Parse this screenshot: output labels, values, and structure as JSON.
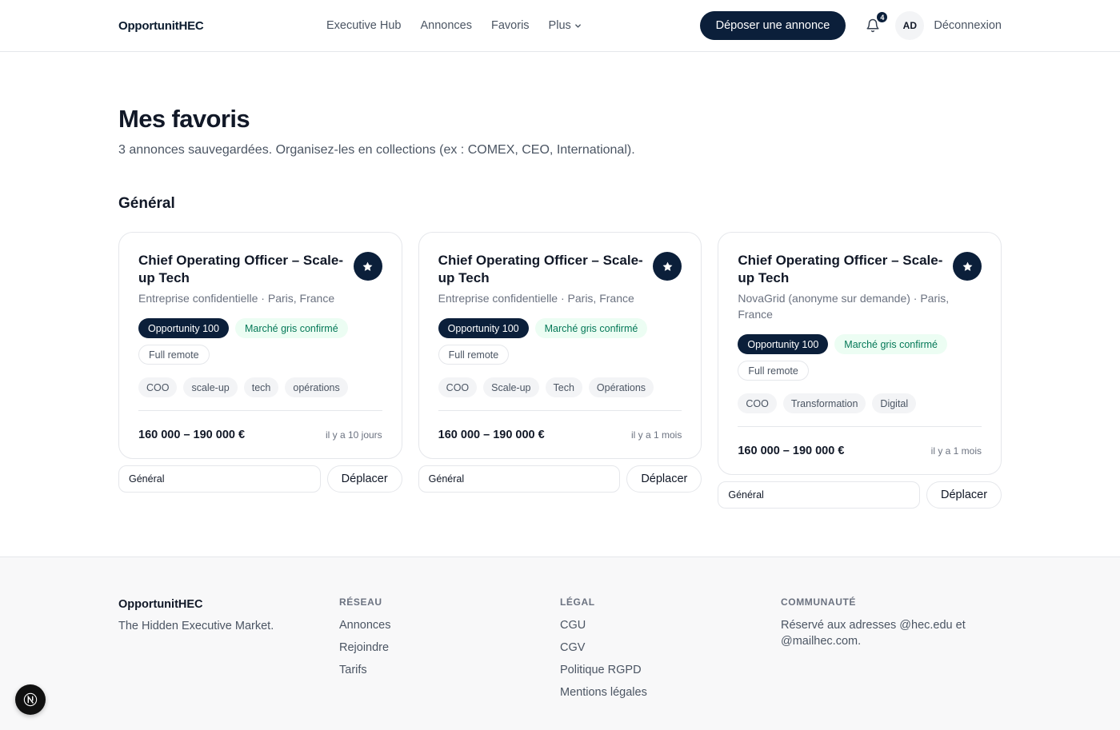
{
  "header": {
    "logo": "OpportunitHEC",
    "nav": [
      "Executive Hub",
      "Annonces",
      "Favoris",
      "Plus"
    ],
    "post_button": "Déposer une annonce",
    "notifications_count": "4",
    "avatar_initials": "AD",
    "logout": "Déconnexion"
  },
  "page": {
    "title": "Mes favoris",
    "subtitle": "3 annonces sauvegardées. Organisez-les en collections (ex : COMEX, CEO, International)."
  },
  "section": {
    "title": "Général"
  },
  "cards": [
    {
      "title": "Chief Operating Officer – Scale-up Tech",
      "meta": "Entreprise confidentielle · Paris, France",
      "badges": {
        "program": "Opportunity 100",
        "market": "Marché gris confirmé",
        "remote": "Full remote"
      },
      "tags": [
        "COO",
        "scale-up",
        "tech",
        "opérations"
      ],
      "price": "160 000 – 190 000 €",
      "ago": "il y a 10 jours",
      "collection": "Général",
      "move_label": "Déplacer"
    },
    {
      "title": "Chief Operating Officer – Scale-up Tech",
      "meta": "Entreprise confidentielle · Paris, France",
      "badges": {
        "program": "Opportunity 100",
        "market": "Marché gris confirmé",
        "remote": "Full remote"
      },
      "tags": [
        "COO",
        "Scale-up",
        "Tech",
        "Opérations"
      ],
      "price": "160 000 – 190 000 €",
      "ago": "il y a 1 mois",
      "collection": "Général",
      "move_label": "Déplacer"
    },
    {
      "title": "Chief Operating Officer – Scale-up Tech",
      "meta": "NovaGrid (anonyme sur demande) · Paris, France",
      "badges": {
        "program": "Opportunity 100",
        "market": "Marché gris confirmé",
        "remote": "Full remote"
      },
      "tags": [
        "COO",
        "Transformation",
        "Digital"
      ],
      "price": "160 000 – 190 000 €",
      "ago": "il y a 1 mois",
      "collection": "Général",
      "move_label": "Déplacer"
    }
  ],
  "footer": {
    "brand": "OpportunitHEC",
    "tagline": "The Hidden Executive Market.",
    "reseau": {
      "heading": "RÉSEAU",
      "links": [
        "Annonces",
        "Rejoindre",
        "Tarifs"
      ]
    },
    "legal": {
      "heading": "LÉGAL",
      "links": [
        "CGU",
        "CGV",
        "Politique RGPD",
        "Mentions légales"
      ]
    },
    "communaute": {
      "heading": "COMMUNAUTÉ",
      "text": "Réservé aux adresses @hec.edu et @mailhec.com."
    }
  },
  "colors": {
    "primary": "#0b1f3a",
    "green_text": "#047857",
    "green_bg": "#ecfdf3"
  }
}
